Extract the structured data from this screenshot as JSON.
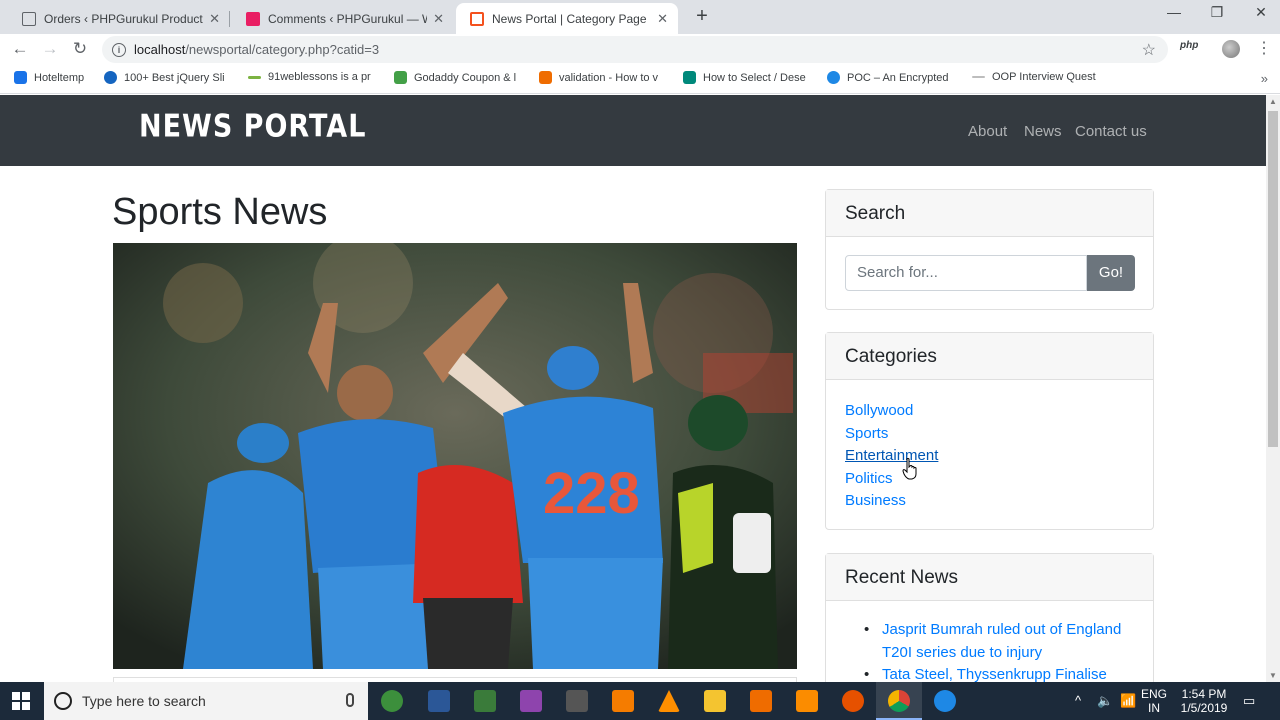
{
  "browser": {
    "tabs": [
      {
        "title": "Orders ‹ PHPGurukul Products —",
        "active": false,
        "icon_color": "#5f6368"
      },
      {
        "title": "Comments ‹ PHPGurukul — Wor",
        "active": false,
        "icon_color": "#e91e63"
      },
      {
        "title": "News Portal | Category Page",
        "active": true,
        "icon_color": "#f4511e"
      }
    ],
    "url_host": "localhost",
    "url_path": "/newsportal/category.php?catid=3",
    "extension_label": "php",
    "bookmarks": [
      {
        "label": "Hoteltemp",
        "icon_color": "#1a73e8"
      },
      {
        "label": "100+ Best jQuery Sli",
        "icon_color": "#1565c0"
      },
      {
        "label": "91weblessons is a pr",
        "icon_color": "#7cb342"
      },
      {
        "label": "Godaddy Coupon & l",
        "icon_color": "#43a047"
      },
      {
        "label": "validation - How to v",
        "icon_color": "#ef6c00"
      },
      {
        "label": "How to Select / Dese",
        "icon_color": "#00897b"
      },
      {
        "label": "POC – An Encrypted",
        "icon_color": "#1e88e5"
      },
      {
        "label": "OOP Interview Quest",
        "icon_color": "#9e9e9e"
      }
    ]
  },
  "site": {
    "brand": "NEWS PORTAL",
    "nav": [
      "About",
      "News",
      "Contact us"
    ],
    "page_title": "Sports News",
    "hero_alt": "Cricket players celebrating",
    "widgets": {
      "search": {
        "title": "Search",
        "placeholder": "Search for...",
        "button": "Go!"
      },
      "categories": {
        "title": "Categories",
        "items": [
          "Bollywood",
          "Sports",
          "Entertainment",
          "Politics",
          "Business"
        ],
        "hovered": "Entertainment"
      },
      "recent": {
        "title": "Recent News",
        "items": [
          "Jasprit Bumrah ruled out of England T20I series due to injury",
          "Tata Steel, Thyssenkrupp Finalise"
        ]
      }
    }
  },
  "taskbar": {
    "search_placeholder": "Type here to search",
    "lang": "ENG",
    "region": "IN",
    "time": "1:54 PM",
    "date": "1/5/2019"
  }
}
